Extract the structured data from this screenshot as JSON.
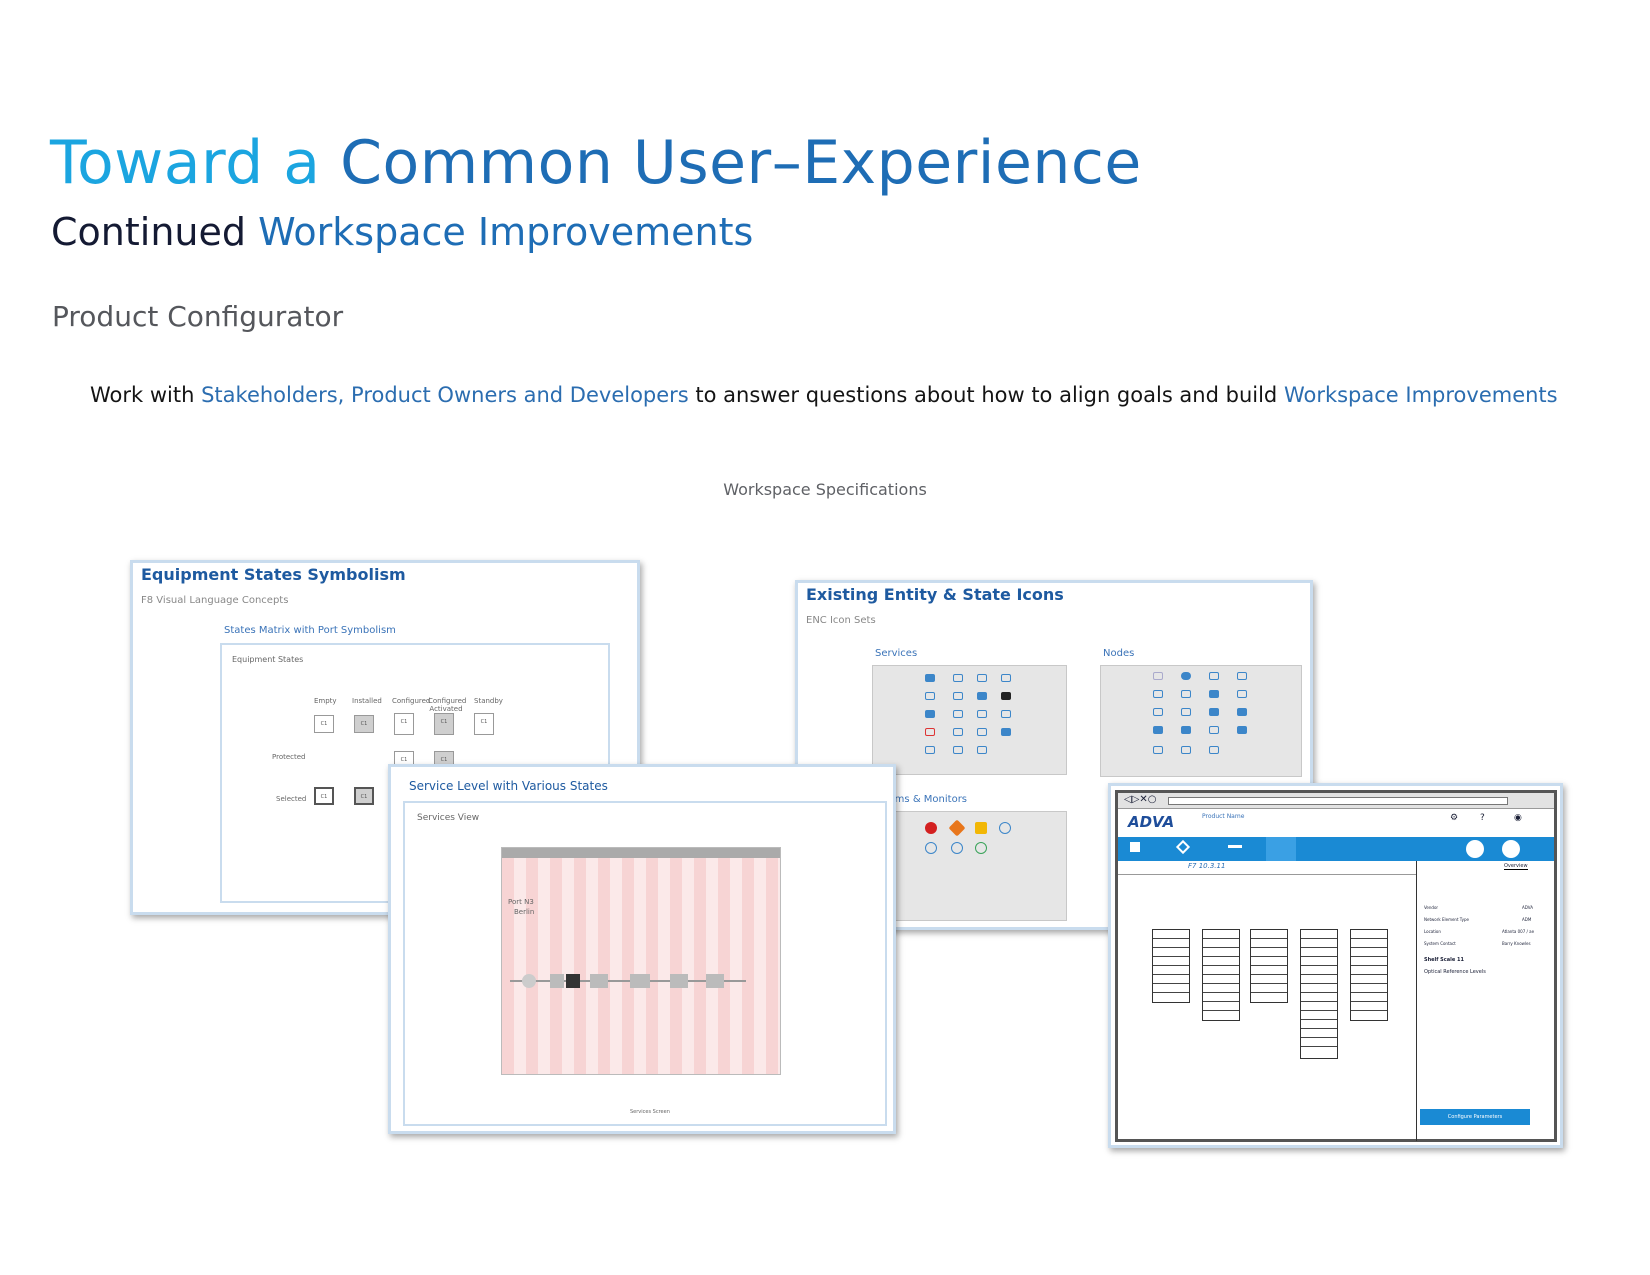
{
  "header": {
    "title_part1": "Toward a ",
    "title_part2": "Common User–Experience",
    "subtitle_part1": "Continued ",
    "subtitle_part2": "Workspace Improvements",
    "section": "Product Configurator"
  },
  "intro": {
    "t1": "Work with ",
    "h1": "Stakeholders, Product Owners and Developers",
    "t2": " to answer questions about how to align goals and build ",
    "h2": "Workspace Improvements"
  },
  "spec_label": "Workspace Specifications",
  "card_equipment": {
    "title": "Equipment States Symbolism",
    "subtitle": "F8 Visual Language Concepts",
    "matrix_label": "States Matrix with Port Symbolism",
    "inner_title": "Equipment States",
    "columns": [
      "Empty",
      "Installed",
      "Configured",
      "Configured Activated",
      "Standby"
    ],
    "rows": [
      "Protected",
      "Selected"
    ]
  },
  "card_service": {
    "title": "Service Level with Various States",
    "subtitle": "Services View",
    "footer": "Services Screen",
    "port": "Port N3",
    "berlin": "Berlin"
  },
  "card_icons": {
    "title": "Existing Entity & State Icons",
    "subtitle": "ENC Icon Sets",
    "services": "Services",
    "nodes": "Nodes",
    "alarms": "Alarms & Monitors"
  },
  "card_adva": {
    "logo": "ADVA",
    "product_name": "Product Name",
    "breadcrumb": "F7 10.3.11",
    "overview_tab": "Overview",
    "shelf": "Shelf Scale 11",
    "optical": "Optical Reference Levels",
    "configure_button": "Configure Parameters",
    "props": [
      "Vendor",
      "Network Element Type",
      "Location",
      "System Contact"
    ],
    "prop_values": [
      "ADVA",
      "ADM",
      "Atlanta 007 / ae",
      "Barry Knowles"
    ]
  }
}
